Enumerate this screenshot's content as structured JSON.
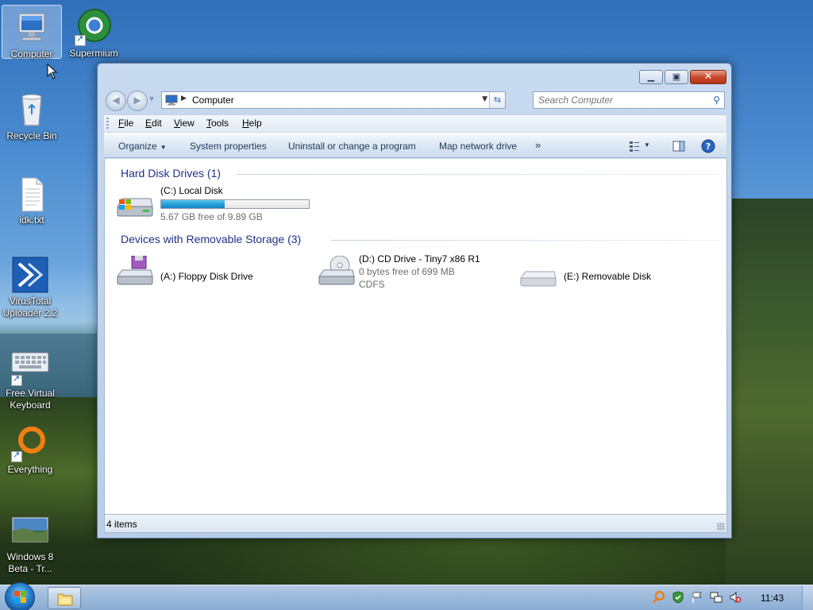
{
  "desktop": {
    "icons": [
      {
        "label": "Computer"
      },
      {
        "label": "Supermium"
      },
      {
        "label": "Recycle Bin"
      },
      {
        "label": "idk.txt"
      },
      {
        "label": "VirusTotal Uploader 2.2"
      },
      {
        "label": "Free Virtual Keyboard"
      },
      {
        "label": "Everything"
      },
      {
        "label": "Windows 8 Beta - Tr..."
      }
    ]
  },
  "window": {
    "address": {
      "path": "Computer"
    },
    "search": {
      "placeholder": "Search Computer"
    },
    "menu": [
      "File",
      "Edit",
      "View",
      "Tools",
      "Help"
    ],
    "commands": {
      "organize": "Organize",
      "system_properties": "System properties",
      "uninstall": "Uninstall or change a program",
      "map_drive": "Map network drive",
      "more": "»"
    },
    "groups": {
      "hdd": {
        "title": "Hard Disk Drives (1)"
      },
      "removable": {
        "title": "Devices with Removable Storage (3)"
      }
    },
    "drives": {
      "c": {
        "name": "(C:) Local Disk",
        "free": "5.67 GB free of 9.89 GB",
        "used_fraction": 0.43
      },
      "a": {
        "name": "(A:) Floppy Disk Drive"
      },
      "d": {
        "name": "(D:) CD Drive - Tiny7 x86 R1",
        "free": "0 bytes free of 699 MB",
        "fs": "CDFS"
      },
      "e": {
        "name": "(E:) Removable Disk"
      }
    },
    "status": {
      "items": "4 items"
    }
  },
  "taskbar": {
    "clock": "11:43"
  }
}
